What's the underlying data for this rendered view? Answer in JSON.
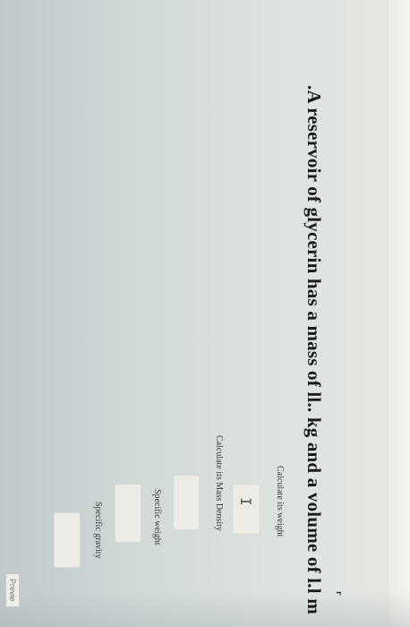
{
  "question": {
    "text": ".A reservoir of glycerin has a mass of ll.. kg and a volume of l.l m",
    "superscript_mark": "r"
  },
  "fields": {
    "weight_label": "Calculate its weight",
    "weight_cursor": "I",
    "density_label": "Calculate its  Mass Density",
    "specific_weight_label": "Specific weight",
    "specific_gravity_label": "Specific gravity"
  },
  "footer": {
    "preview_label": "Previe"
  }
}
